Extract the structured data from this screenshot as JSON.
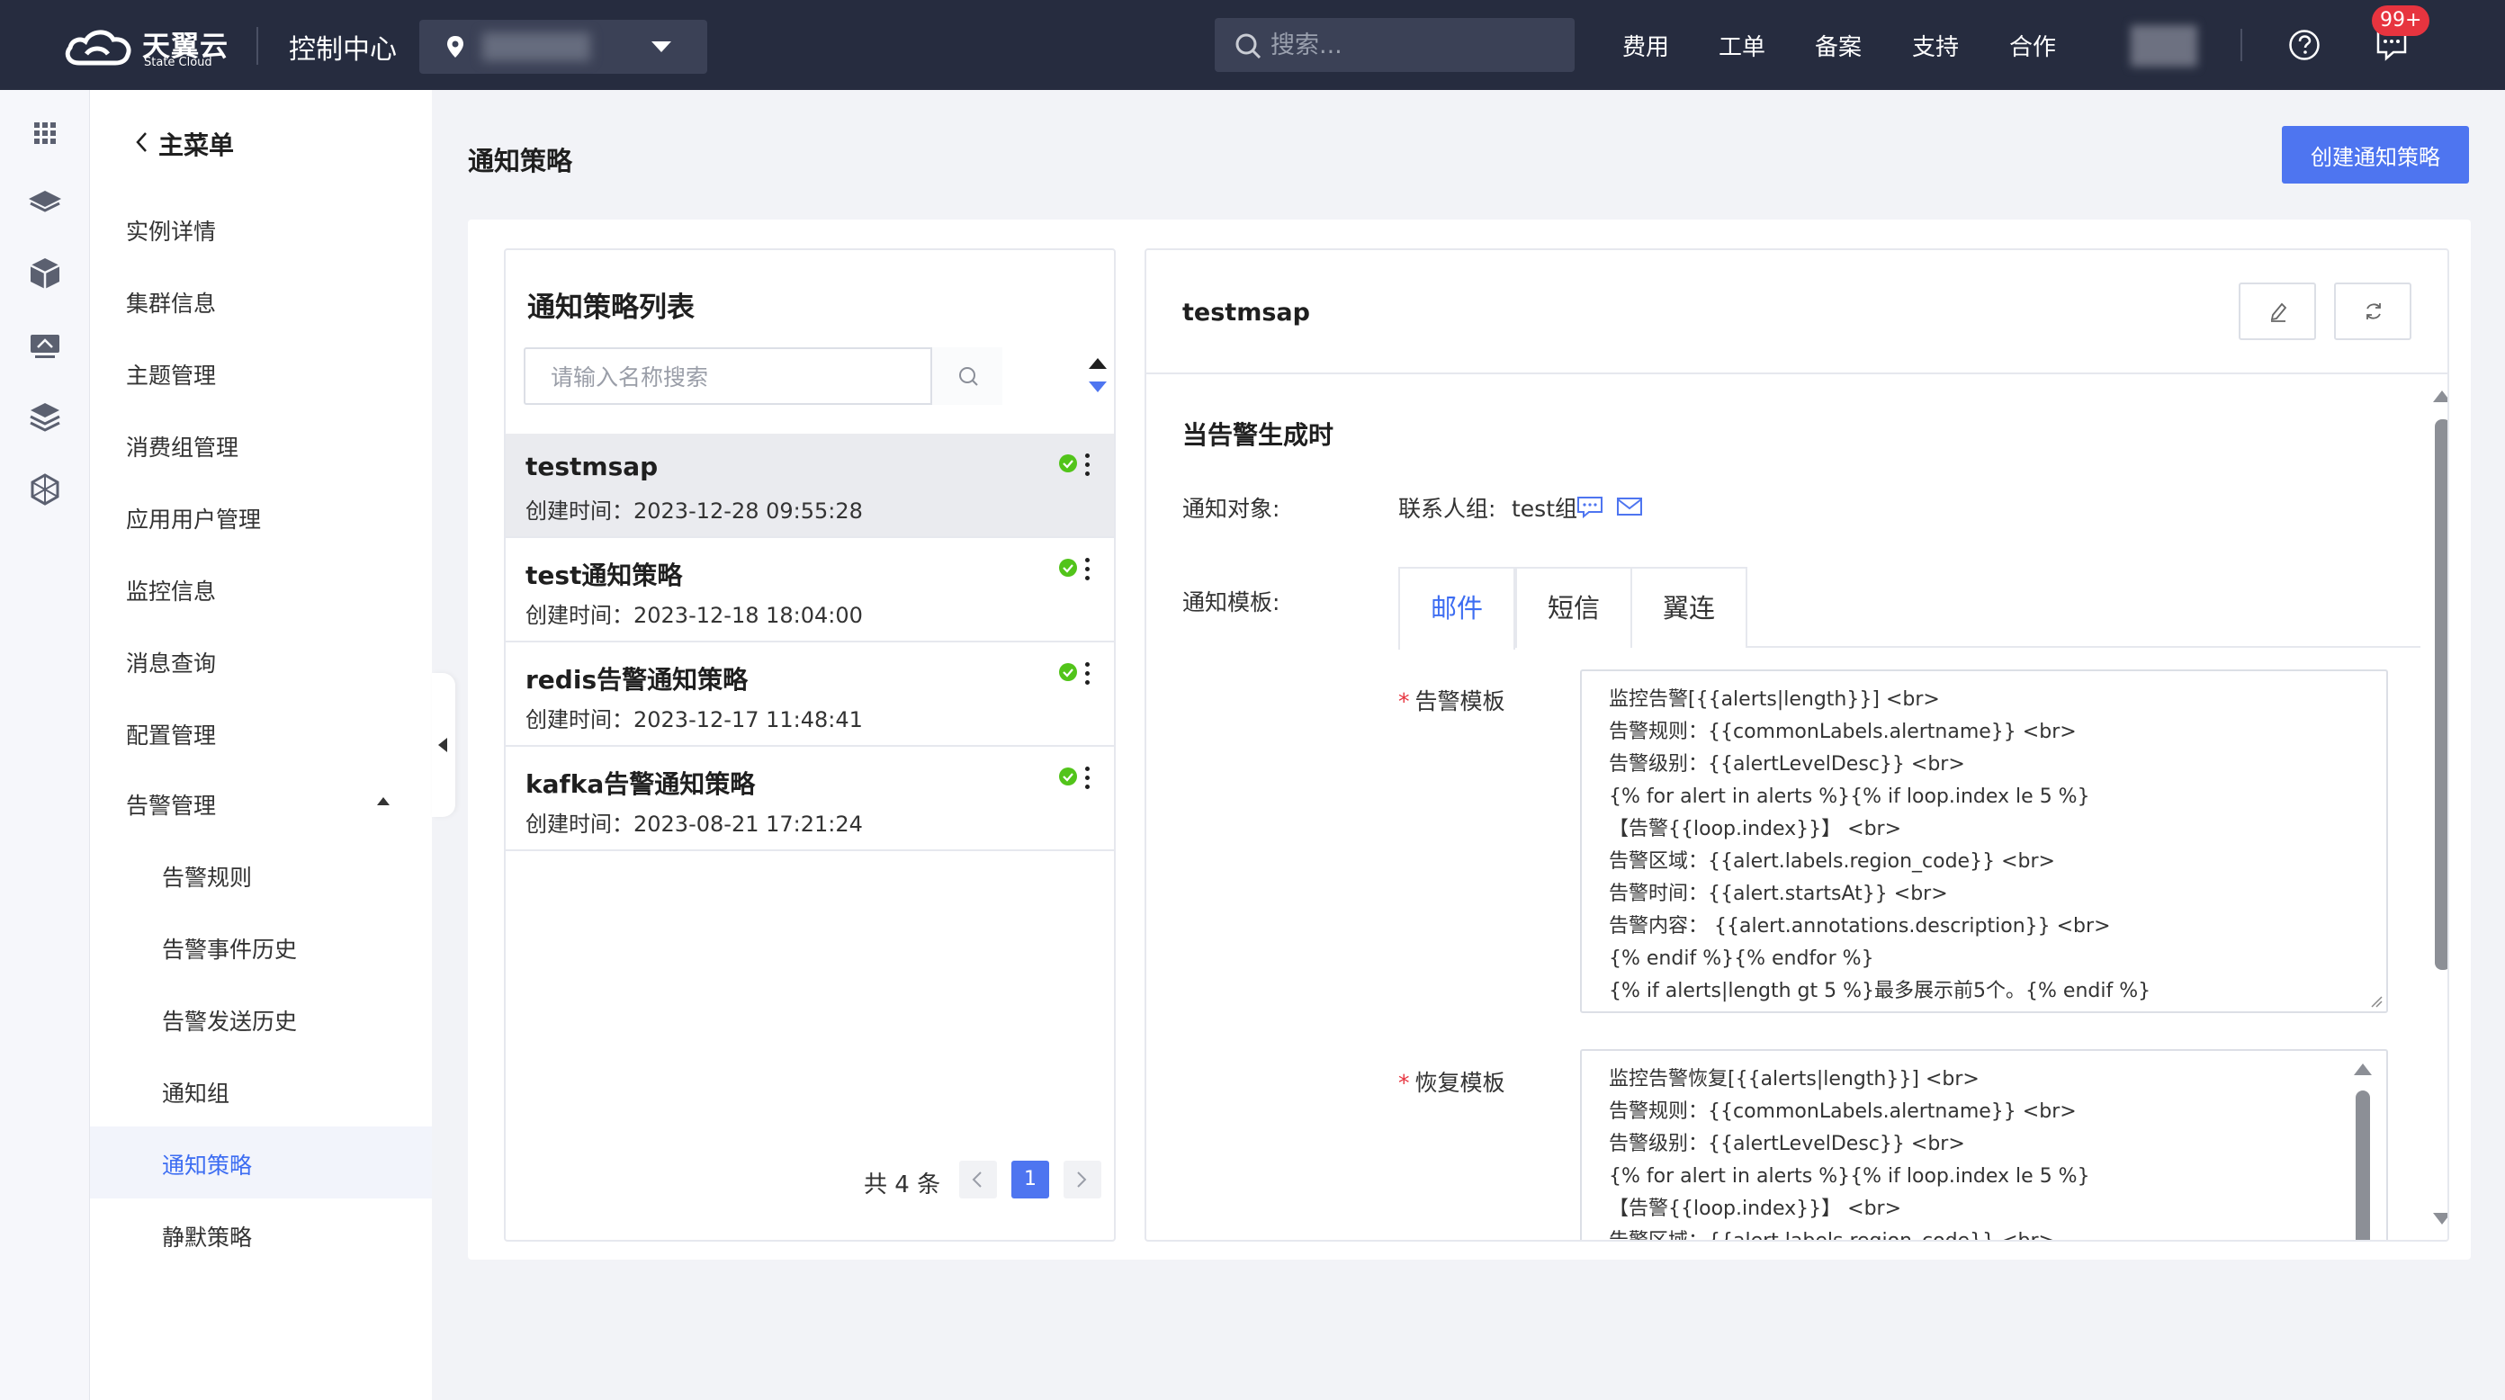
{
  "topbar": {
    "brand_name": "天翼云",
    "brand_sub": "State Cloud",
    "control_center": "控制中心",
    "search_placeholder": "搜索...",
    "nav": [
      "费用",
      "工单",
      "备案",
      "支持",
      "合作"
    ],
    "message_badge": "99+",
    "icons": [
      "brand-cloud-icon",
      "location-pin-icon",
      "chevron-down-icon",
      "search-icon",
      "help-icon",
      "message-icon"
    ]
  },
  "rail": {
    "icons": [
      "grid-icon",
      "layers-icon",
      "box-icon",
      "monitor-icon",
      "stack-icon",
      "cube-network-icon"
    ]
  },
  "sidebar": {
    "back_label": "主菜单",
    "items": [
      "实例详情",
      "集群信息",
      "主题管理",
      "消费组管理",
      "应用用户管理",
      "监控信息",
      "消息查询",
      "配置管理",
      "告警管理"
    ],
    "sub_items": [
      "告警规则",
      "告警事件历史",
      "告警发送历史",
      "通知组",
      "通知策略",
      "静默策略"
    ],
    "active": "通知策略"
  },
  "page": {
    "title": "通知策略",
    "create_button": "创建通知策略"
  },
  "list": {
    "title": "通知策略列表",
    "search_placeholder": "请输入名称搜索",
    "items": [
      {
        "name": "testmsap",
        "time_label": "创建时间：",
        "time": "2023-12-28 09:55:28"
      },
      {
        "name": "test通知策略",
        "time_label": "创建时间：",
        "time": "2023-12-18 18:04:00"
      },
      {
        "name": "redis告警通知策略",
        "time_label": "创建时间：",
        "time": "2023-12-17 11:48:41"
      },
      {
        "name": "kafka告警通知策略",
        "time_label": "创建时间：",
        "time": "2023-08-21 17:21:24"
      }
    ],
    "status_color": "#52c41a",
    "pager": {
      "total": "共 4 条",
      "current": "1"
    }
  },
  "detail": {
    "name": "testmsap",
    "section_title": "当告警生成时",
    "notify_target_label": "通知对象:",
    "contact_group_label": "联系人组:",
    "contact_group_value": "test组",
    "notify_template_label": "通知模板:",
    "tabs": [
      "邮件",
      "短信",
      "翼连"
    ],
    "active_tab": "邮件",
    "alert_template_label": "告警模板",
    "alert_template": "监控告警[{{alerts|length}}] <br>\n告警规则：{{commonLabels.alertname}} <br>\n告警级别：{{alertLevelDesc}} <br>\n{% for alert in alerts %}{% if loop.index le 5 %}\n【告警{{loop.index}}】 <br>\n告警区域：{{alert.labels.region_code}} <br>\n告警时间：{{alert.startsAt}} <br>\n告警内容： {{alert.annotations.description}} <br>\n{% endif %}{% endfor %}\n{% if alerts|length gt 5 %}最多展示前5个。{% endif %}",
    "recovery_template_label": "恢复模板",
    "recovery_template": "监控告警恢复[{{alerts|length}}] <br>\n告警规则：{{commonLabels.alertname}} <br>\n告警级别：{{alertLevelDesc}} <br>\n{% for alert in alerts %}{% if loop.index le 5 %}\n【告警{{loop.index}}】 <br>\n告警区域：{{alert.labels.region_code}} <br>",
    "accent_color": "#3d6df2"
  }
}
